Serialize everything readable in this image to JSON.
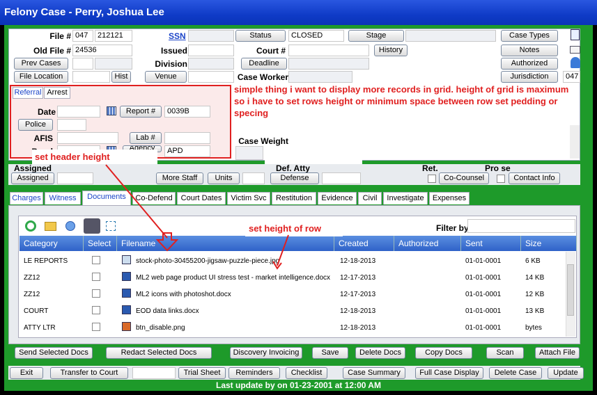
{
  "window": {
    "title": "Felony Case - Perry, Joshua Lee"
  },
  "case": {
    "file_label": "File #",
    "file_a": "047",
    "file_b": "212121",
    "ssn_label": "SSN",
    "status_btn": "Status",
    "status_value": "CLOSED",
    "stage_btn": "Stage",
    "case_types_btn": "Case Types",
    "old_file_label": "Old File #",
    "old_file_value": "24536",
    "issued_label": "Issued",
    "court_label": "Court #",
    "history_btn": "History",
    "notes_btn": "Notes",
    "prev_cases_btn": "Prev Cases",
    "division_label": "Division",
    "deadline_btn": "Deadline",
    "authorized_btn": "Authorized",
    "file_location_btn": "File Location",
    "hist_btn": "Hist",
    "venue_btn": "Venue",
    "case_worker_label": "Case Worker",
    "jurisdiction_btn": "Jurisdiction",
    "jurisdiction_value": "047",
    "case_weight_label": "Case Weight"
  },
  "referral": {
    "tab_referral": "Referral",
    "tab_arrest": "Arrest",
    "date_label": "Date",
    "report_btn": "Report #",
    "report_value": "0039B",
    "police_btn": "Police",
    "afis_label": "AFIS",
    "lab_btn": "Lab #",
    "bond_label": "Bond",
    "agency_btn": "Agency",
    "agency_value": "APD"
  },
  "annotations": {
    "main_note": "simple thing i want to display more records in grid.  height of grid is maximum so i have to set rows height or minimum space between row set pedding or specing",
    "header_note": "set header height",
    "row_note": "set height of row"
  },
  "staff": {
    "assigned_label": "Assigned",
    "assigned_btn": "Assigned",
    "more_staff_btn": "More Staff",
    "units_btn": "Units",
    "def_atty_label": "Def. Atty",
    "defense_btn": "Defense",
    "ret_label": "Ret.",
    "pro_se_label": "Pro se",
    "co_counsel_btn": "Co-Counsel",
    "contact_info_btn": "Contact Info"
  },
  "tabs": [
    "Charges",
    "Witness",
    "Documents",
    "Co-Defend",
    "Court Dates",
    "Victim Svc",
    "Restitution",
    "Evidence",
    "Civil",
    "Investigate",
    "Expenses"
  ],
  "grid": {
    "filter_label": "Filter by",
    "columns": [
      "Category",
      "Select",
      "Filename",
      "Created",
      "Authorized",
      "Sent",
      "Size"
    ],
    "rows": [
      {
        "category": "LE REPORTS",
        "filename": "stock-photo-30455200-jigsaw-puzzle-piece.jpg",
        "created": "12-18-2013",
        "sent": "01-01-0001",
        "size": "6 KB"
      },
      {
        "category": "ZZ12",
        "filename": "ML2 web page product UI stress test - market intelligence.docx",
        "created": "12-17-2013",
        "sent": "01-01-0001",
        "size": "14 KB"
      },
      {
        "category": "ZZ12",
        "filename": "ML2 icons with photoshot.docx",
        "created": "12-17-2013",
        "sent": "01-01-0001",
        "size": "12 KB"
      },
      {
        "category": "COURT",
        "filename": "EOD data links.docx",
        "created": "12-18-2013",
        "sent": "01-01-0001",
        "size": "13 KB"
      },
      {
        "category": "ATTY LTR",
        "filename": "btn_disable.png",
        "created": "12-18-2013",
        "sent": "01-01-0001",
        "size": "bytes"
      }
    ]
  },
  "doc_actions": [
    "Send Selected Docs",
    "Redact Selected Docs",
    "Discovery Invoicing",
    "Save",
    "Delete Docs",
    "Copy Docs",
    "Scan",
    "Attach File"
  ],
  "footer": {
    "buttons": [
      "Exit",
      "Transfer to Court",
      "Trial Sheet",
      "Reminders",
      "Checklist",
      "Case Summary",
      "Full Case Display",
      "Delete Case",
      "Update"
    ],
    "status": "Last update by on 01-23-2001 at 12:00 AM"
  },
  "colors": {
    "title": "#0f3bc7",
    "frame": "#1e9a2a",
    "grid_header": "#3a6fd0",
    "annotation": "#e02020"
  }
}
